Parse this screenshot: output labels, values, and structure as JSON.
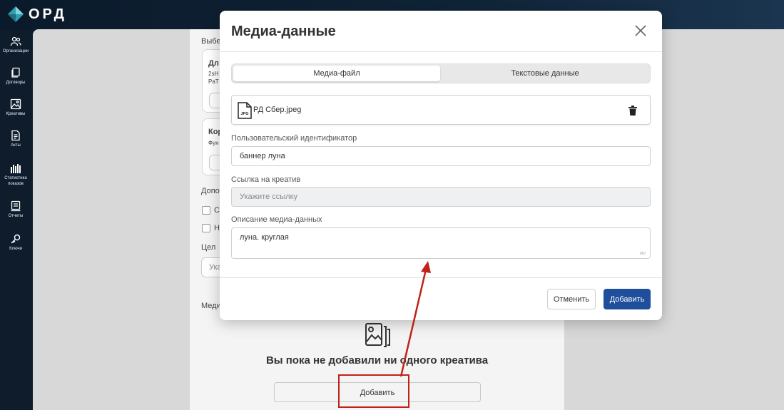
{
  "app": {
    "logo_text": "ОРД"
  },
  "sidebar": {
    "items": [
      {
        "label": "Организации",
        "icon": "users-icon"
      },
      {
        "label": "Договоры",
        "icon": "documents-icon"
      },
      {
        "label": "Креативы",
        "icon": "image-icon"
      },
      {
        "label": "Акты",
        "icon": "file-text-icon"
      },
      {
        "label": "Статистика показов",
        "icon": "stats-icon"
      },
      {
        "label": "Отчеты",
        "icon": "report-icon"
      },
      {
        "label": "Ключи",
        "icon": "key-icon"
      }
    ]
  },
  "background_form": {
    "select_label": "Выбер",
    "card1_title": "Дл",
    "card1_line1": "2sH",
    "card1_line2": "PaT",
    "card2_title": "Кор",
    "card2_line1": "Фун",
    "additional_label": "Допо",
    "check1_label": "С",
    "check2_label": "Н",
    "target_label": "Цел",
    "target_placeholder": "Ука",
    "media_label": "Меди",
    "empty_state_title": "Вы пока не добавили ни одного креатива",
    "add_button": "Добавить"
  },
  "modal": {
    "title": "Медиа-данные",
    "tabs": [
      {
        "label": "Медиа-файл",
        "active": true
      },
      {
        "label": "Текстовые данные",
        "active": false
      }
    ],
    "file": {
      "name": "РД Сбер.jpeg",
      "icon": "jpg-file-icon",
      "icon_text": "JPG"
    },
    "custom_id": {
      "label": "Пользовательский идентификатор",
      "value": "баннер луна"
    },
    "creative_link": {
      "label": "Ссылка на креатив",
      "placeholder": "Укажите ссылку",
      "value": ""
    },
    "description": {
      "label": "Описание медиа-данных",
      "value": "луна. круглая",
      "counter": "067"
    },
    "cancel_button": "Отменить",
    "submit_button": "Добавить"
  },
  "colors": {
    "primary": "#1f4e9c",
    "sidebar_bg": "#0e1c2b",
    "annotation": "#c0221a",
    "logo_accent": "#3fb8c4"
  }
}
